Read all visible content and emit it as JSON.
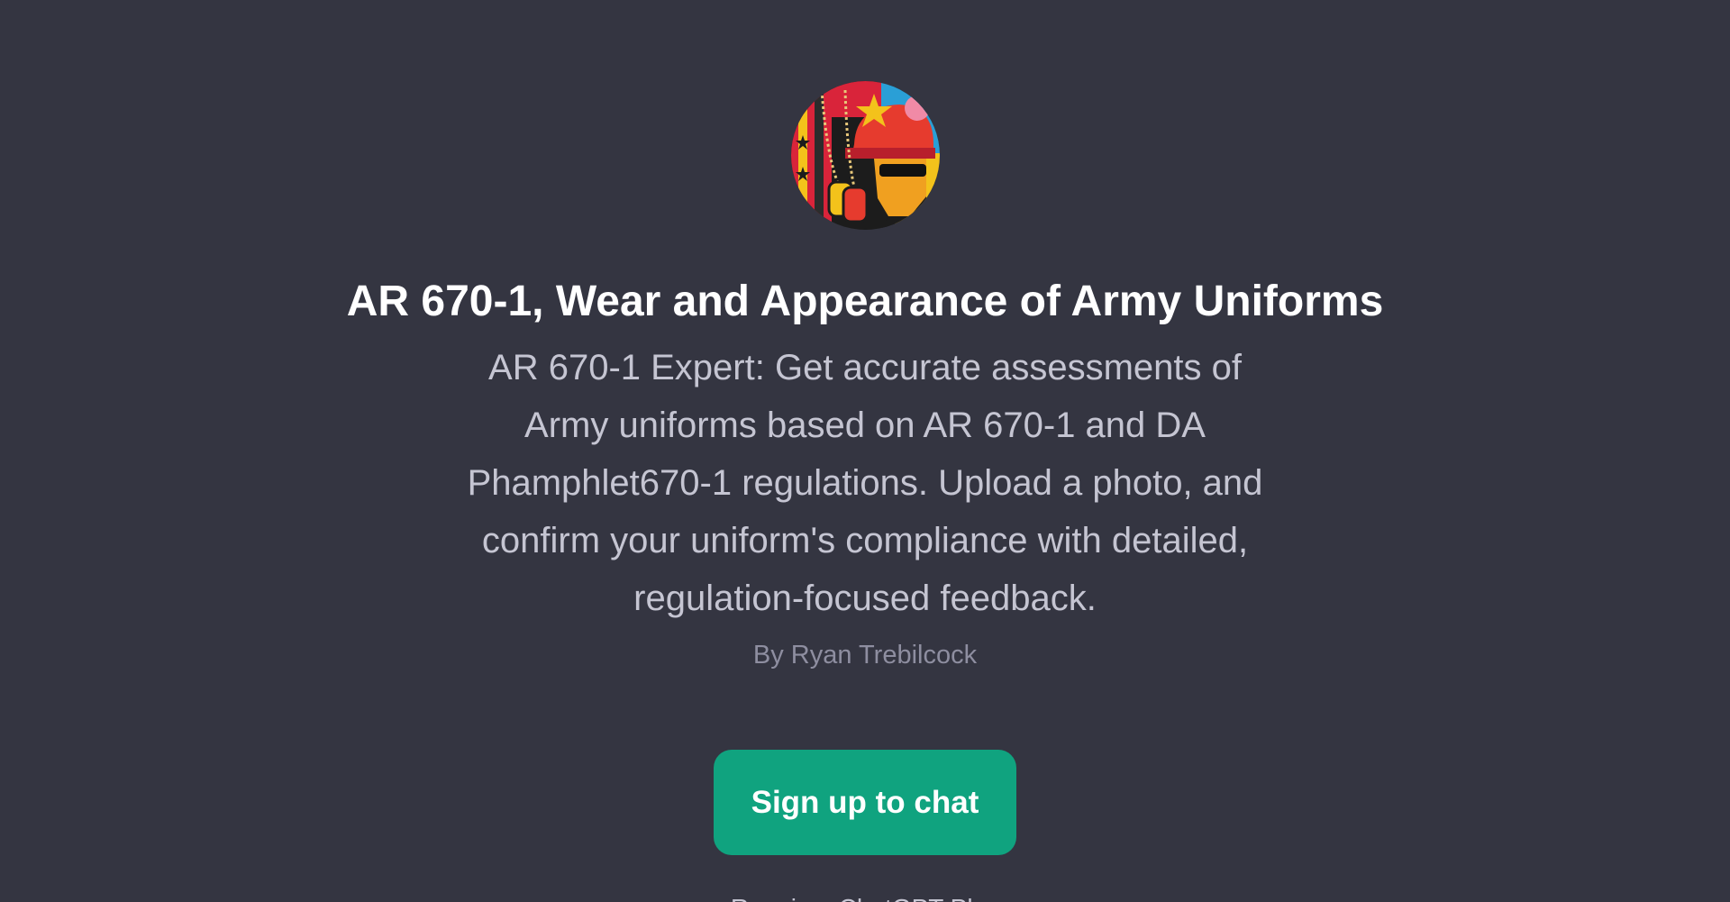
{
  "gpt": {
    "avatar_icon": "soldier-portrait-icon",
    "title": "AR 670-1, Wear and Appearance of Army Uniforms",
    "description_lines": [
      "AR 670-1 Expert: Get accurate assessments of",
      "Army uniforms based on AR 670-1 and DA",
      "Phamphlet670-1 regulations. Upload a photo, and",
      "confirm your uniform's compliance with detailed,",
      "regulation-focused feedback."
    ],
    "author": "By Ryan Trebilcock"
  },
  "cta": {
    "label": "Sign up to chat"
  },
  "footer": {
    "text": "Requires ChatGPT Plus"
  },
  "colors": {
    "background": "#343541",
    "accent": "#10a37f",
    "title": "#ffffff",
    "description": "#c5c5d2",
    "author": "#8e8ea0"
  }
}
